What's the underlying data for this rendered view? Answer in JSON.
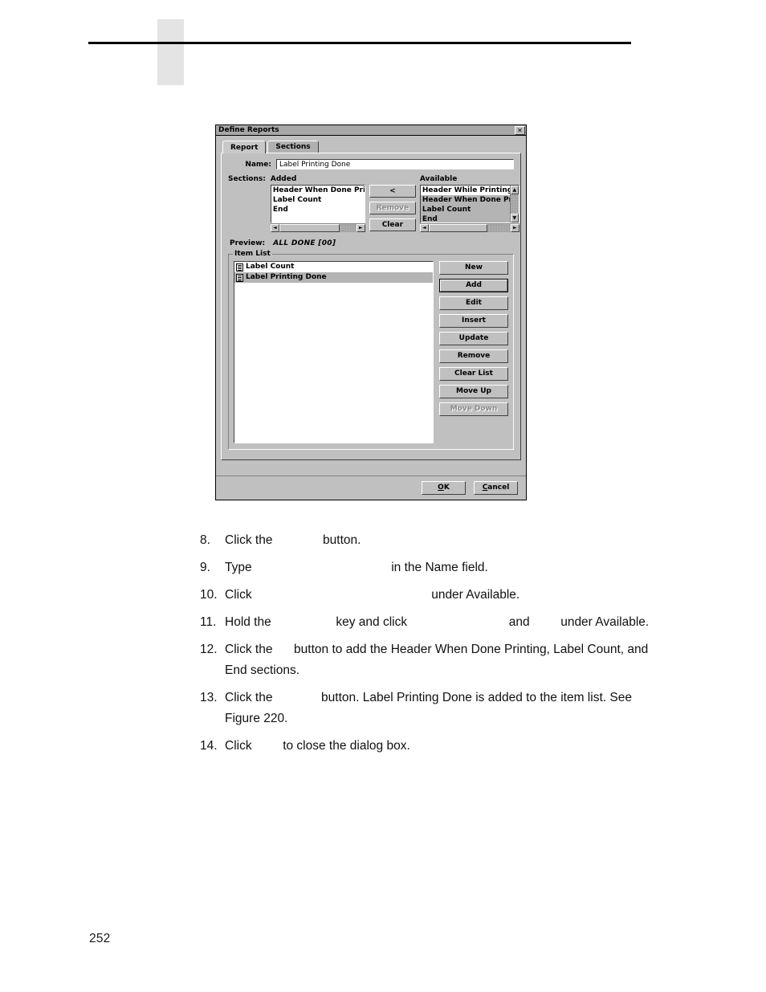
{
  "page": {
    "number": "252"
  },
  "figure": {
    "dialog": {
      "title": "Define Reports",
      "close_icon": "close-icon",
      "tabs": [
        {
          "label": "Report",
          "active": true
        },
        {
          "label": "Sections",
          "active": false
        }
      ],
      "name_field": {
        "label": "Name:",
        "value": "Label Printing Done",
        "placeholder": ""
      },
      "sections": {
        "label": "Sections:",
        "added_header": "Added",
        "available_header": "Available",
        "added_items": [
          {
            "label": "Header When Done Printi",
            "selected": false
          },
          {
            "label": "Label Count",
            "selected": false
          },
          {
            "label": "End",
            "selected": false
          }
        ],
        "available_items": [
          {
            "label": "Header While Printing",
            "selected": false
          },
          {
            "label": "Header When Done Printi",
            "selected": true
          },
          {
            "label": "Label Count",
            "selected": true
          },
          {
            "label": "End",
            "selected": true
          }
        ],
        "move_button": "<",
        "remove_button": "Remove",
        "clear_button": "Clear",
        "scroll_up_glyph": "▲",
        "scroll_down_glyph": "▼",
        "scroll_left_glyph": "◄",
        "scroll_right_glyph": "►"
      },
      "preview": {
        "label": "Preview:",
        "value": "ALL DONE [00]"
      },
      "item_list": {
        "title": "Item List",
        "items": [
          {
            "label": "Label Count",
            "selected": false
          },
          {
            "label": "Label Printing Done",
            "selected": true
          }
        ],
        "buttons": [
          {
            "label": "New",
            "enabled": true,
            "default": false
          },
          {
            "label": "Add",
            "enabled": true,
            "default": true
          },
          {
            "label": "Edit",
            "enabled": true,
            "default": false
          },
          {
            "label": "Insert",
            "enabled": true,
            "default": false
          },
          {
            "label": "Update",
            "enabled": true,
            "default": false
          },
          {
            "label": "Remove",
            "enabled": true,
            "default": false
          },
          {
            "label": "Clear List",
            "enabled": true,
            "default": false
          },
          {
            "label": "Move Up",
            "enabled": true,
            "default": false
          },
          {
            "label": "Move Down",
            "enabled": false,
            "default": false
          }
        ]
      },
      "footer": {
        "ok_button": "OK",
        "ok_mnemonic": "O",
        "cancel_button": "Cancel",
        "cancel_mnemonic": "C"
      }
    }
  },
  "instructions": {
    "steps": [
      {
        "number": "8.",
        "parts": [
          {
            "type": "text",
            "value": "Click the"
          },
          {
            "type": "gap",
            "size": "w1"
          },
          {
            "type": "text",
            "value": "button."
          }
        ]
      },
      {
        "number": "9.",
        "parts": [
          {
            "type": "text",
            "value": "Type"
          },
          {
            "type": "gap",
            "size": "w2"
          },
          {
            "type": "text",
            "value": "in the Name field."
          }
        ]
      },
      {
        "number": "10.",
        "parts": [
          {
            "type": "text",
            "value": "Click"
          },
          {
            "type": "gap",
            "size": "w3"
          },
          {
            "type": "text",
            "value": "under Available."
          }
        ]
      },
      {
        "number": "11.",
        "parts": [
          {
            "type": "text",
            "value": "Hold the"
          },
          {
            "type": "gap",
            "size": "w4"
          },
          {
            "type": "text",
            "value": "key and click"
          },
          {
            "type": "gap",
            "size": "w5"
          },
          {
            "type": "text",
            "value": "and"
          },
          {
            "type": "gap",
            "size": "w6"
          },
          {
            "type": "text",
            "value": "under Available."
          }
        ]
      },
      {
        "number": "12.",
        "parts": [
          {
            "type": "text",
            "value": "Click the"
          },
          {
            "type": "gap",
            "size": "w7"
          },
          {
            "type": "text",
            "value": "button to add the Header When Done Printing, Label Count, and End sections."
          }
        ]
      },
      {
        "number": "13.",
        "parts": [
          {
            "type": "text",
            "value": "Click the"
          },
          {
            "type": "gap",
            "size": "w8"
          },
          {
            "type": "text",
            "value": "button. Label Printing Done is added to the item list. See Figure 220."
          }
        ]
      },
      {
        "number": "14.",
        "parts": [
          {
            "type": "text",
            "value": "Click"
          },
          {
            "type": "gap",
            "size": "w9"
          },
          {
            "type": "text",
            "value": "to close the dialog box."
          }
        ]
      }
    ]
  },
  "colors": {
    "dialog_face": "#c0c0c0",
    "titlebar": "#a8a8a8",
    "selection": "#b4b4b4",
    "field_bg": "#ffffff",
    "header_block": "#e4e4e4",
    "text": "#000000",
    "disabled_text": "#8a8a8a"
  }
}
